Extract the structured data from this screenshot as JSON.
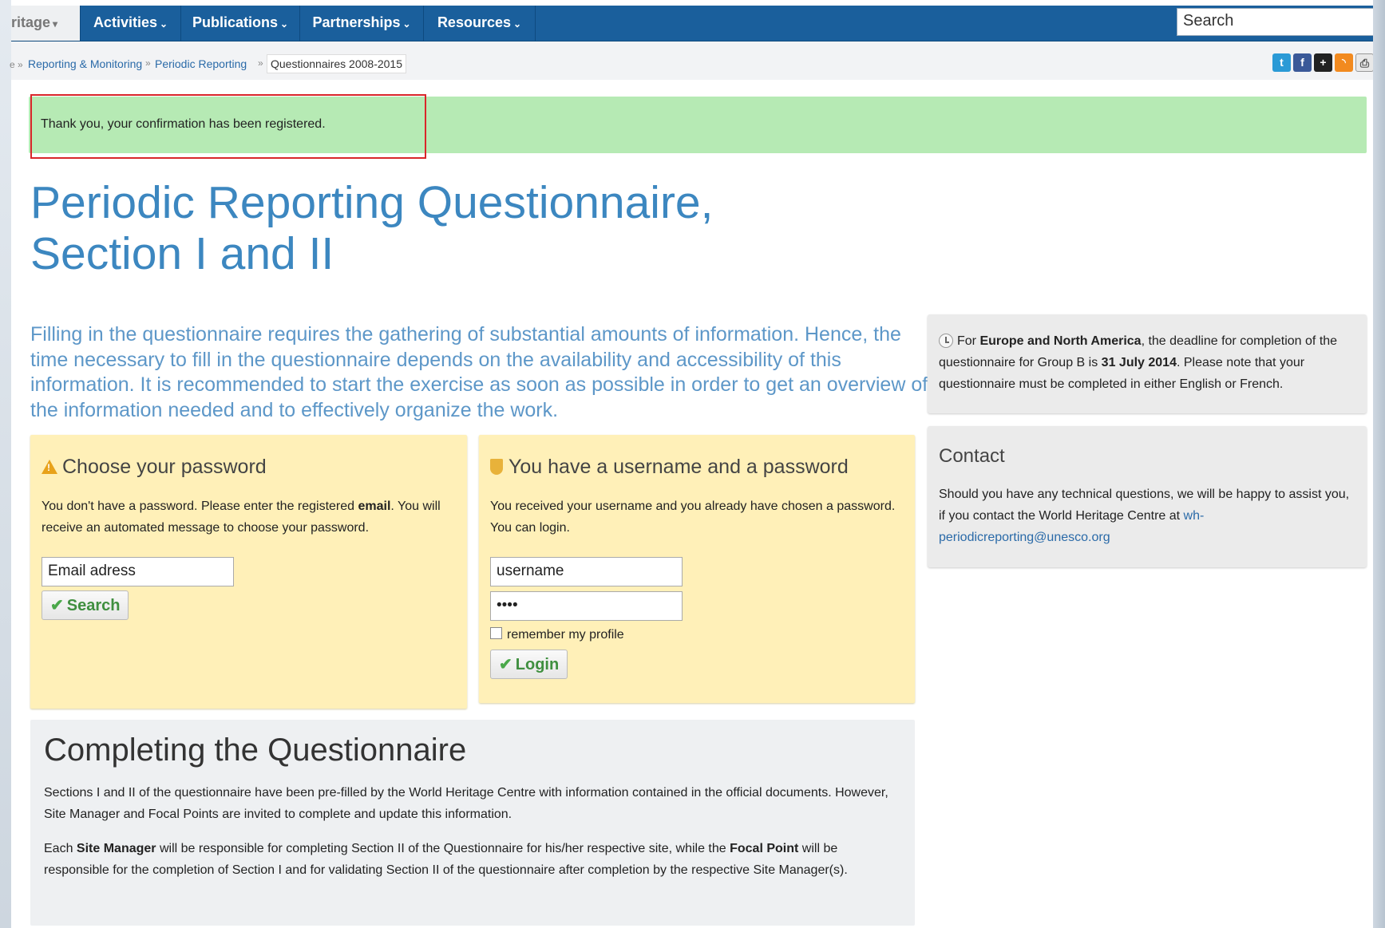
{
  "nav": {
    "heritage": "ritage",
    "items": [
      "Activities",
      "Publications",
      "Partnerships",
      "Resources"
    ],
    "search_placeholder": "Search"
  },
  "breadcrumb": {
    "items": [
      "Reporting & Monitoring",
      "Periodic Reporting"
    ],
    "current": "Questionnaires 2008-2015"
  },
  "social": {
    "icons": [
      "twitter-icon",
      "facebook-icon",
      "addthis-icon",
      "rss-icon",
      "print-icon"
    ],
    "colors": [
      "#2b9ad6",
      "#3b5998",
      "#222222",
      "#f28a1f",
      "#777777"
    ]
  },
  "confirmation": {
    "text": "Thank you, your confirmation has been registered.",
    "bg_color": "#b6eab4",
    "outline_color": "#d9262a"
  },
  "title": {
    "line1": "Periodic Reporting Questionnaire,",
    "line2": "Section I and II"
  },
  "intro": "Filling in the questionnaire requires the gathering of substantial amounts of information. Hence, the time necessary to fill in the questionnaire depends on the availability and accessibility of this information. It is recommended to start the exercise as soon as possible in order to get an overview of the information needed and to effectively organize the work.",
  "deadline": {
    "prefix": "For ",
    "region": "Europe and North America",
    "middle": ", the deadline for completion of the questionnaire for Group B is ",
    "date": "31 July 2014",
    "suffix": ". Please note that your questionnaire must be completed in either English or French."
  },
  "contact": {
    "title": "Contact",
    "text": "Should you have any technical questions, we will be happy to assist you, if you contact the World Heritage Centre at ",
    "email": "wh-periodicreporting@unesco.org"
  },
  "choose_password": {
    "title": "Choose your password",
    "text1": "You don't have a password. Please enter the registered ",
    "text_bold": "email",
    "text2": ". You will receive an automated message to choose your password.",
    "email_value": "Email adress",
    "button": "Search"
  },
  "login": {
    "title": "You have a username and a password",
    "text": "You received your username and you already have chosen a password. You can login.",
    "username_value": "username",
    "password_value": "••••",
    "remember_label": "remember my profile",
    "button": "Login"
  },
  "completing": {
    "title": "Completing the Questionnaire",
    "para1": "Sections I and II of the questionnaire have been pre-filled by the World Heritage Centre with information contained in the official documents. However, Site Manager and Focal Points are invited to complete and update this information.",
    "para2_a": "Each ",
    "para2_b": "Site Manager",
    "para2_c": " will be responsible for completing Section II of the Questionnaire for his/her respective site, while the ",
    "para2_d": "Focal Point",
    "para2_e": " will be responsible for the completion of Section I and for validating Section II of the questionnaire after completion by the respective Site Manager(s)."
  }
}
